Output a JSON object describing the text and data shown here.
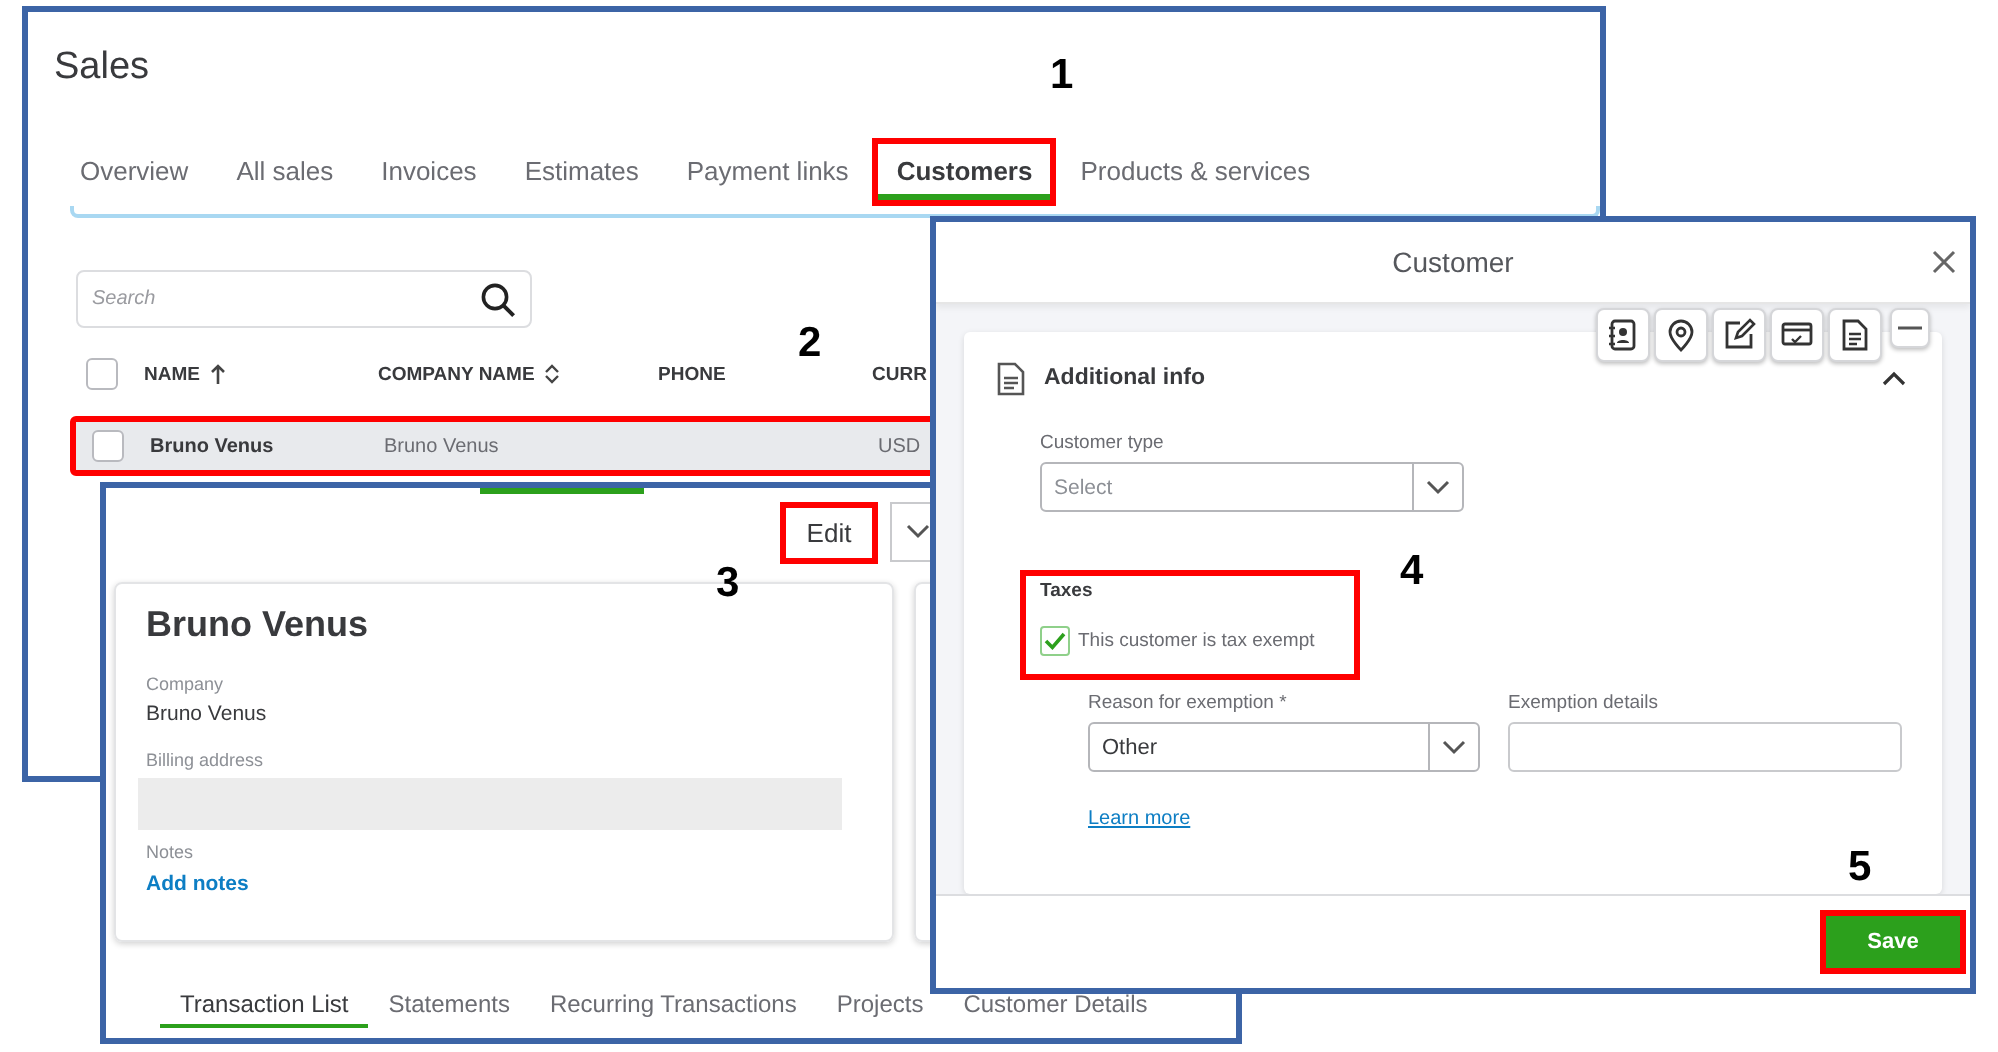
{
  "sales_window": {
    "title": "Sales",
    "tabs": [
      {
        "label": "Overview",
        "selected": false,
        "highlighted": false
      },
      {
        "label": "All sales",
        "selected": false,
        "highlighted": false
      },
      {
        "label": "Invoices",
        "selected": false,
        "highlighted": false
      },
      {
        "label": "Estimates",
        "selected": false,
        "highlighted": false
      },
      {
        "label": "Payment links",
        "selected": false,
        "highlighted": false
      },
      {
        "label": "Customers",
        "selected": true,
        "highlighted": true
      },
      {
        "label": "Products & services",
        "selected": false,
        "highlighted": false
      }
    ],
    "search": {
      "placeholder": "Search"
    },
    "table": {
      "all_checked": false,
      "columns": [
        {
          "label": "NAME",
          "kind": "sorted"
        },
        {
          "label": "COMPANY NAME",
          "kind": "sortable"
        },
        {
          "label": "PHONE",
          "kind": "plain"
        },
        {
          "label": "CURR",
          "kind": "plain"
        }
      ],
      "rows": [
        {
          "checked": false,
          "selected": true,
          "highlighted": true,
          "cells": [
            "Bruno Venus",
            "Bruno Venus",
            "",
            "USD"
          ]
        }
      ]
    }
  },
  "customer_window": {
    "edit_button": {
      "label": "Edit",
      "highlighted": true
    },
    "card": {
      "name": "Bruno Venus",
      "fields": [
        {
          "label": "Company",
          "value": "Bruno Venus"
        },
        {
          "label": "Billing address"
        }
      ],
      "notes_label": "Notes",
      "notes_link": "Add notes"
    },
    "tabs": [
      {
        "label": "Transaction List",
        "selected": true
      },
      {
        "label": "Statements",
        "selected": false
      },
      {
        "label": "Recurring Transactions",
        "selected": false
      },
      {
        "label": "Projects",
        "selected": false
      },
      {
        "label": "Customer Details",
        "selected": false
      }
    ]
  },
  "customer_dialog": {
    "title": "Customer",
    "section": {
      "title": "Additional info",
      "expanded": true,
      "customer_type": {
        "label": "Customer type",
        "placeholder": "Select"
      },
      "taxes": {
        "heading": "Taxes",
        "highlighted": true,
        "exempt": {
          "label": "This customer is tax exempt",
          "checked": true
        }
      },
      "reason": {
        "label": "Reason for exemption *",
        "value": "Other"
      },
      "details": {
        "label": "Exemption details"
      },
      "learn_more": "Learn more"
    },
    "save_button": {
      "label": "Save",
      "highlighted": true
    }
  },
  "annotations": [
    {
      "number": "1"
    },
    {
      "number": "2"
    },
    {
      "number": "3"
    },
    {
      "number": "4"
    },
    {
      "number": "5"
    }
  ]
}
